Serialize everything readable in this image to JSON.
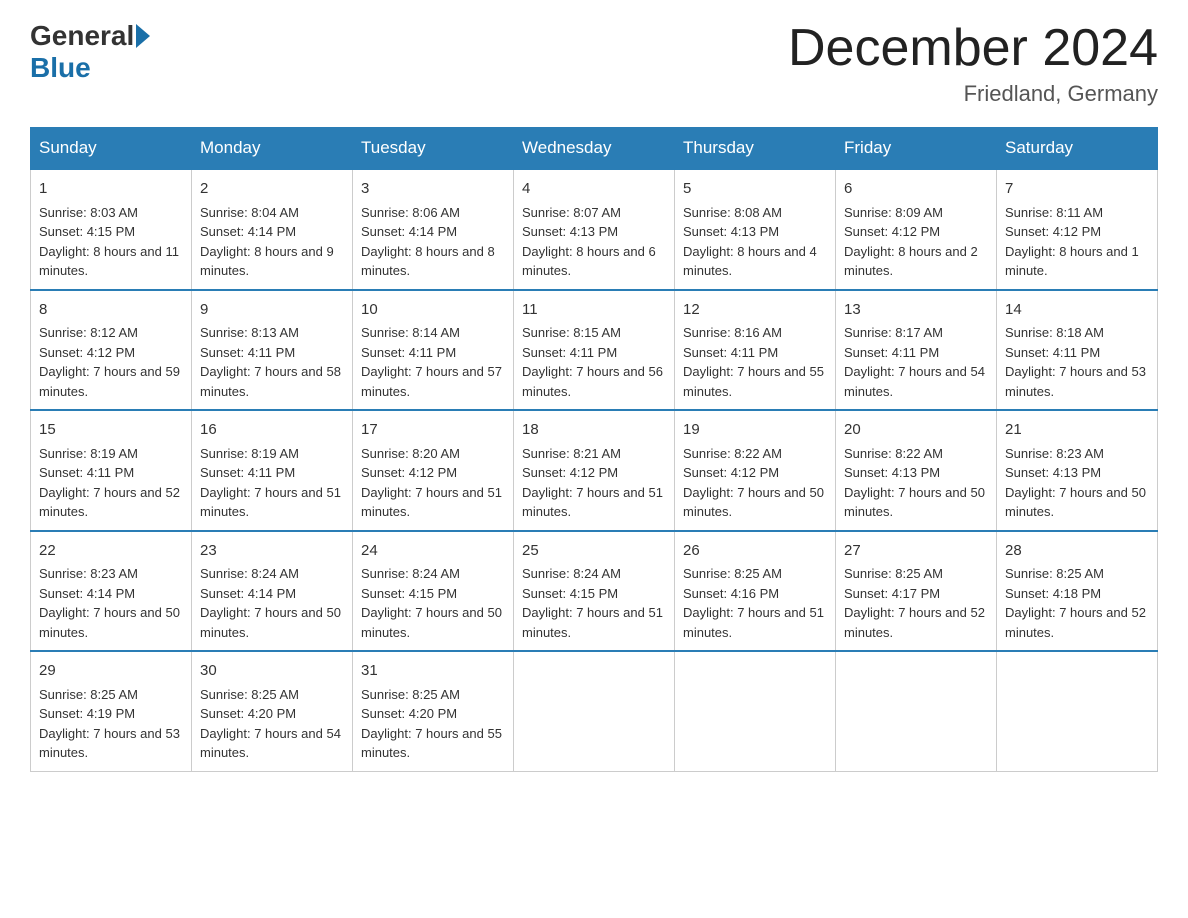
{
  "header": {
    "logo_general": "General",
    "logo_blue": "Blue",
    "month_title": "December 2024",
    "location": "Friedland, Germany"
  },
  "weekdays": [
    "Sunday",
    "Monday",
    "Tuesday",
    "Wednesday",
    "Thursday",
    "Friday",
    "Saturday"
  ],
  "weeks": [
    [
      {
        "day": "1",
        "sunrise": "8:03 AM",
        "sunset": "4:15 PM",
        "daylight": "8 hours and 11 minutes."
      },
      {
        "day": "2",
        "sunrise": "8:04 AM",
        "sunset": "4:14 PM",
        "daylight": "8 hours and 9 minutes."
      },
      {
        "day": "3",
        "sunrise": "8:06 AM",
        "sunset": "4:14 PM",
        "daylight": "8 hours and 8 minutes."
      },
      {
        "day": "4",
        "sunrise": "8:07 AM",
        "sunset": "4:13 PM",
        "daylight": "8 hours and 6 minutes."
      },
      {
        "day": "5",
        "sunrise": "8:08 AM",
        "sunset": "4:13 PM",
        "daylight": "8 hours and 4 minutes."
      },
      {
        "day": "6",
        "sunrise": "8:09 AM",
        "sunset": "4:12 PM",
        "daylight": "8 hours and 2 minutes."
      },
      {
        "day": "7",
        "sunrise": "8:11 AM",
        "sunset": "4:12 PM",
        "daylight": "8 hours and 1 minute."
      }
    ],
    [
      {
        "day": "8",
        "sunrise": "8:12 AM",
        "sunset": "4:12 PM",
        "daylight": "7 hours and 59 minutes."
      },
      {
        "day": "9",
        "sunrise": "8:13 AM",
        "sunset": "4:11 PM",
        "daylight": "7 hours and 58 minutes."
      },
      {
        "day": "10",
        "sunrise": "8:14 AM",
        "sunset": "4:11 PM",
        "daylight": "7 hours and 57 minutes."
      },
      {
        "day": "11",
        "sunrise": "8:15 AM",
        "sunset": "4:11 PM",
        "daylight": "7 hours and 56 minutes."
      },
      {
        "day": "12",
        "sunrise": "8:16 AM",
        "sunset": "4:11 PM",
        "daylight": "7 hours and 55 minutes."
      },
      {
        "day": "13",
        "sunrise": "8:17 AM",
        "sunset": "4:11 PM",
        "daylight": "7 hours and 54 minutes."
      },
      {
        "day": "14",
        "sunrise": "8:18 AM",
        "sunset": "4:11 PM",
        "daylight": "7 hours and 53 minutes."
      }
    ],
    [
      {
        "day": "15",
        "sunrise": "8:19 AM",
        "sunset": "4:11 PM",
        "daylight": "7 hours and 52 minutes."
      },
      {
        "day": "16",
        "sunrise": "8:19 AM",
        "sunset": "4:11 PM",
        "daylight": "7 hours and 51 minutes."
      },
      {
        "day": "17",
        "sunrise": "8:20 AM",
        "sunset": "4:12 PM",
        "daylight": "7 hours and 51 minutes."
      },
      {
        "day": "18",
        "sunrise": "8:21 AM",
        "sunset": "4:12 PM",
        "daylight": "7 hours and 51 minutes."
      },
      {
        "day": "19",
        "sunrise": "8:22 AM",
        "sunset": "4:12 PM",
        "daylight": "7 hours and 50 minutes."
      },
      {
        "day": "20",
        "sunrise": "8:22 AM",
        "sunset": "4:13 PM",
        "daylight": "7 hours and 50 minutes."
      },
      {
        "day": "21",
        "sunrise": "8:23 AM",
        "sunset": "4:13 PM",
        "daylight": "7 hours and 50 minutes."
      }
    ],
    [
      {
        "day": "22",
        "sunrise": "8:23 AM",
        "sunset": "4:14 PM",
        "daylight": "7 hours and 50 minutes."
      },
      {
        "day": "23",
        "sunrise": "8:24 AM",
        "sunset": "4:14 PM",
        "daylight": "7 hours and 50 minutes."
      },
      {
        "day": "24",
        "sunrise": "8:24 AM",
        "sunset": "4:15 PM",
        "daylight": "7 hours and 50 minutes."
      },
      {
        "day": "25",
        "sunrise": "8:24 AM",
        "sunset": "4:15 PM",
        "daylight": "7 hours and 51 minutes."
      },
      {
        "day": "26",
        "sunrise": "8:25 AM",
        "sunset": "4:16 PM",
        "daylight": "7 hours and 51 minutes."
      },
      {
        "day": "27",
        "sunrise": "8:25 AM",
        "sunset": "4:17 PM",
        "daylight": "7 hours and 52 minutes."
      },
      {
        "day": "28",
        "sunrise": "8:25 AM",
        "sunset": "4:18 PM",
        "daylight": "7 hours and 52 minutes."
      }
    ],
    [
      {
        "day": "29",
        "sunrise": "8:25 AM",
        "sunset": "4:19 PM",
        "daylight": "7 hours and 53 minutes."
      },
      {
        "day": "30",
        "sunrise": "8:25 AM",
        "sunset": "4:20 PM",
        "daylight": "7 hours and 54 minutes."
      },
      {
        "day": "31",
        "sunrise": "8:25 AM",
        "sunset": "4:20 PM",
        "daylight": "7 hours and 55 minutes."
      },
      null,
      null,
      null,
      null
    ]
  ],
  "labels": {
    "sunrise": "Sunrise:",
    "sunset": "Sunset:",
    "daylight": "Daylight:"
  }
}
